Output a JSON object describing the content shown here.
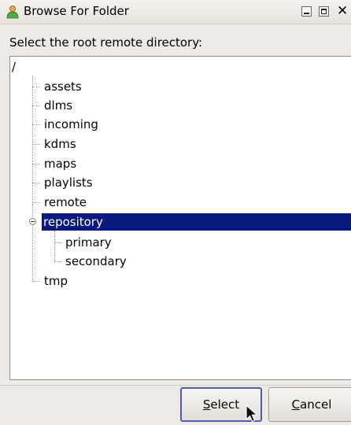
{
  "window": {
    "title": "Browse For Folder",
    "close_glyph": "✕"
  },
  "prompt": "Select the root remote directory:",
  "tree": {
    "root": "/",
    "items": [
      {
        "label": "assets"
      },
      {
        "label": "dlms"
      },
      {
        "label": "incoming"
      },
      {
        "label": "kdms"
      },
      {
        "label": "maps"
      },
      {
        "label": "playlists"
      },
      {
        "label": "remote"
      },
      {
        "label": "repository",
        "selected": true,
        "expanded": true,
        "children": [
          {
            "label": "primary"
          },
          {
            "label": "secondary"
          }
        ]
      },
      {
        "label": "tmp"
      }
    ]
  },
  "buttons": {
    "select": {
      "mnemonic": "S",
      "rest": "elect"
    },
    "cancel": {
      "mnemonic": "C",
      "rest": "ancel"
    }
  },
  "colors": {
    "selection_bg": "#0a1a7e",
    "selection_fg": "#ffffff",
    "window_bg": "#ece9e6"
  },
  "icons": {
    "app": "user-icon",
    "expander": "collapse-circle-icon",
    "cursor": "mouse-pointer-icon"
  }
}
